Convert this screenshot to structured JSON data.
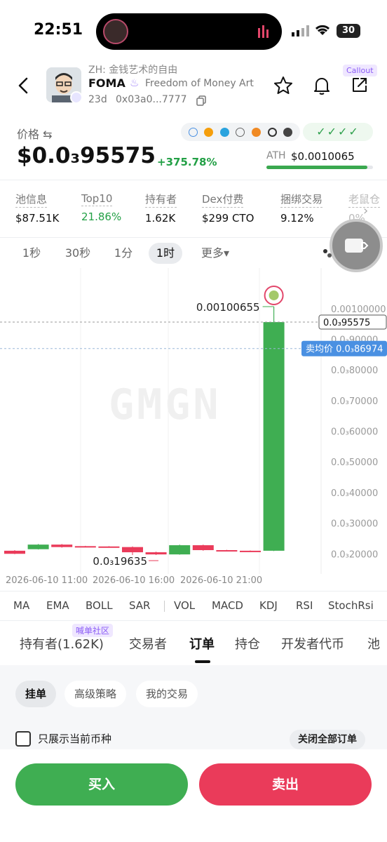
{
  "status_bar": {
    "time": "22:51",
    "battery": "30"
  },
  "token": {
    "zh_name": "ZH: 金钱艺术的自由",
    "symbol": "FOMA",
    "name": "Freedom of Money Art",
    "age": "23d",
    "address": "0x03a0...7777",
    "callout_badge": "Callout"
  },
  "price_section": {
    "label": "价格 ⇆",
    "price": "$0.0₃95575",
    "change": "+375.78%",
    "ath_label": "ATH",
    "ath_value": "$0.0010065",
    "ath_progress": 0.95,
    "checks": "✓✓✓✓"
  },
  "stats": [
    {
      "label": "池信息",
      "value": "$87.51K"
    },
    {
      "label": "Top10",
      "value": "21.86%"
    },
    {
      "label": "持有者",
      "value": "1.62K"
    },
    {
      "label": "Dex付费",
      "value": "$299 CTO"
    },
    {
      "label": "捆绑交易",
      "value": "9.12%"
    },
    {
      "label": "老鼠仓",
      "value": "0%"
    }
  ],
  "timeframes": [
    "1秒",
    "30秒",
    "1分",
    "1时",
    "更多▾"
  ],
  "active_timeframe": "1时",
  "chart_data": {
    "type": "candlestick",
    "watermark": "GMGN",
    "y_ticks": [
      "0.00100000",
      "0.0₃90000",
      "0.0₃80000",
      "0.0₃70000",
      "0.0₃60000",
      "0.0₃50000",
      "0.0₃40000",
      "0.0₃30000",
      "0.0₃20000"
    ],
    "ylim": [
      0.00018,
      0.00105
    ],
    "x_ticks": [
      "2026-06-10 11:00",
      "2026-06-10 16:00",
      "2026-06-10 21:00"
    ],
    "candles": [
      {
        "open": 0.00021,
        "close": 0.0002,
        "high": 0.000212,
        "low": 0.000199
      },
      {
        "open": 0.000215,
        "close": 0.00023,
        "high": 0.000232,
        "low": 0.000214
      },
      {
        "open": 0.00023,
        "close": 0.000222,
        "high": 0.000232,
        "low": 0.00022
      },
      {
        "open": 0.000225,
        "close": 0.000223,
        "high": 0.000226,
        "low": 0.000222
      },
      {
        "open": 0.000224,
        "close": 0.000222,
        "high": 0.000225,
        "low": 0.000221
      },
      {
        "open": 0.000222,
        "close": 0.000205,
        "high": 0.000224,
        "low": 0.000196
      },
      {
        "open": 0.000205,
        "close": 0.000198,
        "high": 0.000207,
        "low": 0.000196
      },
      {
        "open": 0.000198,
        "close": 0.000228,
        "high": 0.00023,
        "low": 0.000197
      },
      {
        "open": 0.000228,
        "close": 0.000212,
        "high": 0.00023,
        "low": 0.00021
      },
      {
        "open": 0.000212,
        "close": 0.00021,
        "high": 0.000213,
        "low": 0.000209
      },
      {
        "open": 0.00021,
        "close": 0.000207,
        "high": 0.000211,
        "low": 0.000206
      },
      {
        "open": 0.00021,
        "close": 0.000956,
        "high": 0.00100655,
        "low": 0.000209
      }
    ],
    "high_label": "0.00100655",
    "low_label": "0.0₃19635",
    "current_price_label": "0.0₃95575",
    "avg_sell_label": "卖均价",
    "avg_sell_value": "0.0₃86974",
    "avg_sell_price": 0.00086974
  },
  "indicators": [
    "MA",
    "EMA",
    "BOLL",
    "SAR",
    "VOL",
    "MACD",
    "KDJ",
    "RSI",
    "StochRsi"
  ],
  "tabs": [
    "持有者(1.62K)",
    "交易者",
    "订单",
    "持仓",
    "开发者代币",
    "池"
  ],
  "tab_badge": "喊单社区",
  "active_tab": "订单",
  "order_pills": [
    "挂单",
    "高级策略",
    "我的交易"
  ],
  "checkbox_label": "只展示当前币种",
  "close_all_label": "关闭全部订单",
  "buy_label": "买入",
  "sell_label": "卖出",
  "colors": {
    "green": "#3fae52",
    "red": "#ea3b5a",
    "purple": "#8b5cf6",
    "blue_tag": "#4a90e2"
  }
}
